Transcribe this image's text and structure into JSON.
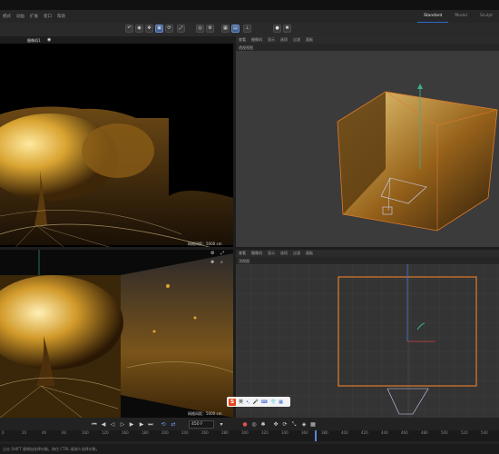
{
  "menubar": {
    "items": [
      "模式",
      "动画",
      "扩展",
      "窗口",
      "帮助"
    ]
  },
  "layout_tabs": [
    "Standard",
    "Model",
    "Sculpt"
  ],
  "viewports": {
    "perspective": {
      "camera_label": "摄像机1",
      "grid_label": "网格间距：5000 cm",
      "grid_label_short": "网格间距：5000 cm"
    },
    "top": {
      "menu": [
        "查看",
        "摄像机",
        "显示",
        "选项",
        "过滤",
        "面板"
      ],
      "title": "透视视图"
    },
    "right": {
      "menu": [
        "查看",
        "摄像机",
        "显示",
        "选项",
        "过滤",
        "面板"
      ],
      "title": "顶视图"
    }
  },
  "timeline": {
    "frame_field": "450 F",
    "ticks": [
      "0",
      "20",
      "40",
      "60",
      "100",
      "120",
      "160",
      "180",
      "200",
      "240",
      "260",
      "280",
      "300",
      "320",
      "340",
      "360",
      "380",
      "400",
      "420",
      "440",
      "460",
      "480",
      "500",
      "520",
      "540"
    ]
  },
  "status": {
    "text": "点击 SHIFT 键增加选择对象。按住 CTRL 键减少选择对象。"
  },
  "ime": {
    "logo": "S",
    "mode": "英"
  }
}
